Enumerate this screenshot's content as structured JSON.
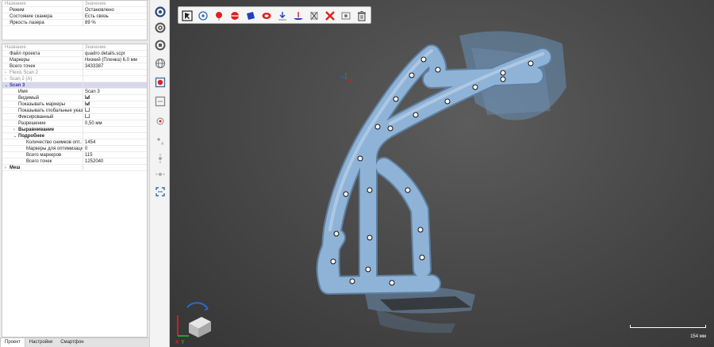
{
  "top_panel": {
    "header": [
      "Название",
      "Значение"
    ],
    "rows": [
      {
        "name": "Режим",
        "value": "Остановлено"
      },
      {
        "name": "Состояние сканера",
        "value": "Есть связь"
      },
      {
        "name": "Яркость лазера",
        "value": "89 %"
      }
    ]
  },
  "bottom_panel": {
    "header": [
      "Название",
      "Значение"
    ],
    "file": {
      "name": "Файл проекта",
      "value": "quadro details.scpr"
    },
    "markers": {
      "name": "Маркеры",
      "value": "Низкий (Пленка)  6,0 мм"
    },
    "total_points": {
      "name": "Всего точек",
      "value": "3433387"
    },
    "scan_a": "Flexis Scan 2",
    "scan_b": "Scan 2 (A)",
    "scan_sel": "Scan 3",
    "props": {
      "name_label": "Имя",
      "name_value": "Scan 3",
      "visible": "Видимый",
      "show_markers": "Показывать маркеры",
      "show_global": "Показывать глобальные указ...",
      "fixed": "Фиксированный",
      "resolution_label": "Разрешение",
      "resolution_value": "0,50 мм"
    },
    "align": "Выравнивание",
    "details": "Подробнее",
    "detail_rows": [
      {
        "name": "Количество снимков опт...",
        "value": "1454"
      },
      {
        "name": "Маркеры для оптимизации",
        "value": "0"
      },
      {
        "name": "Всего маркеров",
        "value": "115"
      },
      {
        "name": "Всего точек",
        "value": "1252040"
      }
    ],
    "mesh": "Меш"
  },
  "tabs": [
    "Проект",
    "Настройки",
    "Смартфон"
  ],
  "scale_label": "154 мм",
  "axis_labels": {
    "x": "X",
    "y": "Y"
  },
  "colors": {
    "tube": "#8fb3d6",
    "marker": "#ffffff",
    "cloud": "#6e9ac7",
    "accent": "#3a3aa0"
  }
}
